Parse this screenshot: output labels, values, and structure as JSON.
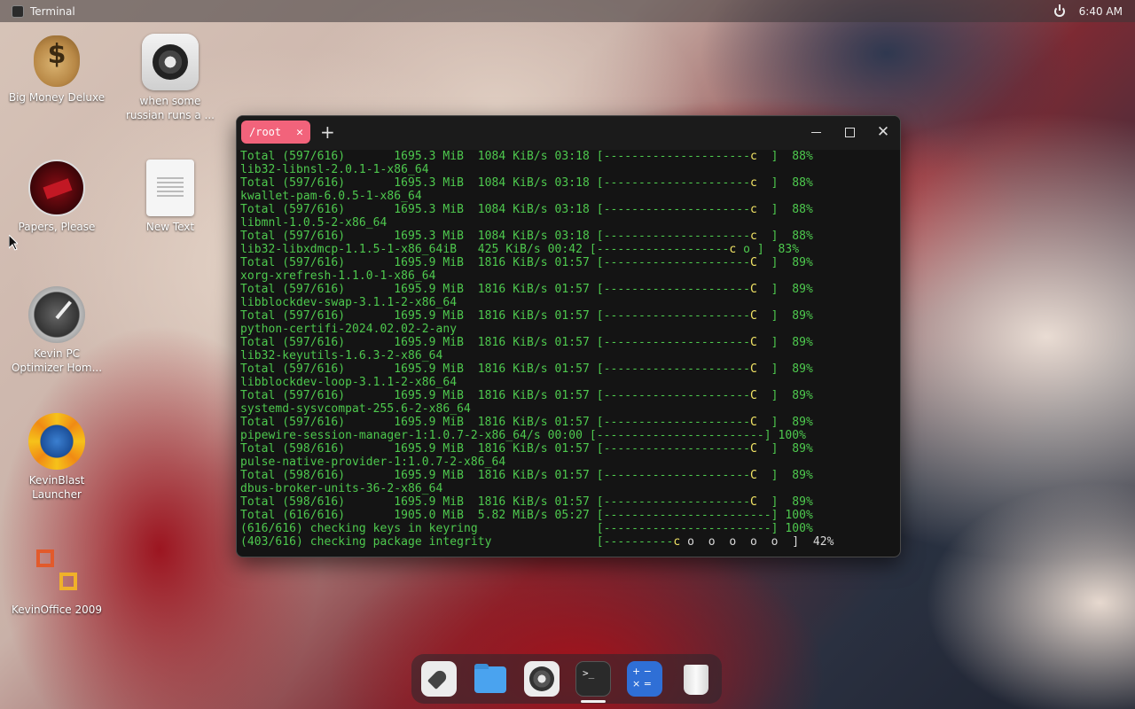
{
  "topbar": {
    "app_name": "Terminal",
    "clock": "6:40 AM"
  },
  "desktop_icons": [
    {
      "label": "Big Money Deluxe",
      "icon": "money-bag-icon"
    },
    {
      "label": "when some russian runs a ...",
      "icon": "settings-gear-icon"
    },
    {
      "label": "Papers, Please",
      "icon": "papers-please-icon"
    },
    {
      "label": "New Text",
      "icon": "text-document-icon"
    },
    {
      "label": "Kevin PC Optimizer Hom...",
      "icon": "gauge-icon"
    },
    {
      "label": "KevinBlast Launcher",
      "icon": "blast-launcher-icon"
    },
    {
      "label": "KevinOffice 2009",
      "icon": "office-icon"
    }
  ],
  "terminal": {
    "tab_label": "/root",
    "lines": [
      {
        "text": "Total (597/616)       1695.3 MiB  1084 KiB/s 03:18 [---------------------",
        "pac": "c",
        "tail": "  ]  88%"
      },
      {
        "text": "lib32-libnsl-2.0.1-1-x86_64",
        "pac": "",
        "tail": ""
      },
      {
        "text": "Total (597/616)       1695.3 MiB  1084 KiB/s 03:18 [---------------------",
        "pac": "c",
        "tail": "  ]  88%"
      },
      {
        "text": "kwallet-pam-6.0.5-1-x86_64",
        "pac": "",
        "tail": ""
      },
      {
        "text": "Total (597/616)       1695.3 MiB  1084 KiB/s 03:18 [---------------------",
        "pac": "c",
        "tail": "  ]  88%"
      },
      {
        "text": "libmnl-1.0.5-2-x86_64",
        "pac": "",
        "tail": ""
      },
      {
        "text": "Total (597/616)       1695.3 MiB  1084 KiB/s 03:18 [---------------------",
        "pac": "c",
        "tail": "  ]  88%"
      },
      {
        "text": "lib32-libxdmcp-1.1.5-1-x86_64iB   425 KiB/s 00:42 [-------------------",
        "pac": "c",
        "tail": " o ]  83%"
      },
      {
        "text": "Total (597/616)       1695.9 MiB  1816 KiB/s 01:57 [---------------------",
        "pac": "C",
        "tail": "  ]  89%"
      },
      {
        "text": "xorg-xrefresh-1.1.0-1-x86_64",
        "pac": "",
        "tail": ""
      },
      {
        "text": "Total (597/616)       1695.9 MiB  1816 KiB/s 01:57 [---------------------",
        "pac": "C",
        "tail": "  ]  89%"
      },
      {
        "text": "libblockdev-swap-3.1.1-2-x86_64",
        "pac": "",
        "tail": ""
      },
      {
        "text": "Total (597/616)       1695.9 MiB  1816 KiB/s 01:57 [---------------------",
        "pac": "C",
        "tail": "  ]  89%"
      },
      {
        "text": "python-certifi-2024.02.02-2-any",
        "pac": "",
        "tail": ""
      },
      {
        "text": "Total (597/616)       1695.9 MiB  1816 KiB/s 01:57 [---------------------",
        "pac": "C",
        "tail": "  ]  89%"
      },
      {
        "text": "lib32-keyutils-1.6.3-2-x86_64",
        "pac": "",
        "tail": ""
      },
      {
        "text": "Total (597/616)       1695.9 MiB  1816 KiB/s 01:57 [---------------------",
        "pac": "C",
        "tail": "  ]  89%"
      },
      {
        "text": "libblockdev-loop-3.1.1-2-x86_64",
        "pac": "",
        "tail": ""
      },
      {
        "text": "Total (597/616)       1695.9 MiB  1816 KiB/s 01:57 [---------------------",
        "pac": "C",
        "tail": "  ]  89%"
      },
      {
        "text": "systemd-sysvcompat-255.6-2-x86_64",
        "pac": "",
        "tail": ""
      },
      {
        "text": "Total (597/616)       1695.9 MiB  1816 KiB/s 01:57 [---------------------",
        "pac": "C",
        "tail": "  ]  89%"
      },
      {
        "text": "pipewire-session-manager-1:1.0.7-2-x86_64/s 00:00 [------------------------] 100%",
        "pac": "",
        "tail": ""
      },
      {
        "text": "Total (598/616)       1695.9 MiB  1816 KiB/s 01:57 [---------------------",
        "pac": "C",
        "tail": "  ]  89%"
      },
      {
        "text": "pulse-native-provider-1:1.0.7-2-x86_64",
        "pac": "",
        "tail": ""
      },
      {
        "text": "Total (598/616)       1695.9 MiB  1816 KiB/s 01:57 [---------------------",
        "pac": "C",
        "tail": "  ]  89%"
      },
      {
        "text": "dbus-broker-units-36-2-x86_64",
        "pac": "",
        "tail": ""
      },
      {
        "text": "Total (598/616)       1695.9 MiB  1816 KiB/s 01:57 [---------------------",
        "pac": "C",
        "tail": "  ]  89%"
      },
      {
        "text": "Total (616/616)       1905.0 MiB  5.82 MiB/s 05:27 [------------------------] 100%",
        "pac": "",
        "tail": ""
      },
      {
        "text": "(616/616) checking keys in keyring                 [------------------------] 100%",
        "pac": "",
        "tail": ""
      },
      {
        "text": "(403/616) checking package integrity               [----------",
        "pac": "c",
        "tail": " o  o  o  o  o  ]  42%",
        "dots": true
      }
    ]
  },
  "dock": {
    "items": [
      "launcher",
      "files",
      "settings",
      "terminal",
      "calculator",
      "trash"
    ],
    "terminal_glyph": ">_"
  }
}
